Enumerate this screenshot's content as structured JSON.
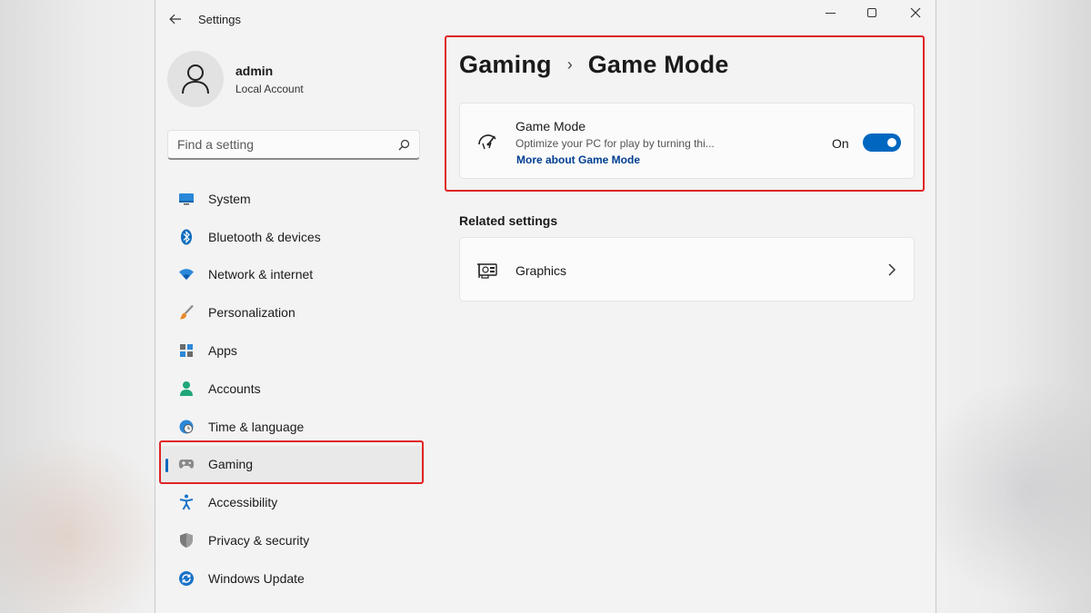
{
  "window": {
    "app_title": "Settings"
  },
  "user": {
    "name": "admin",
    "account_type": "Local Account"
  },
  "search": {
    "placeholder": "Find a setting"
  },
  "sidebar": {
    "items": [
      {
        "label": "System",
        "icon": "monitor-icon"
      },
      {
        "label": "Bluetooth & devices",
        "icon": "bluetooth-icon"
      },
      {
        "label": "Network & internet",
        "icon": "wifi-icon"
      },
      {
        "label": "Personalization",
        "icon": "brush-icon"
      },
      {
        "label": "Apps",
        "icon": "apps-icon"
      },
      {
        "label": "Accounts",
        "icon": "person-icon"
      },
      {
        "label": "Time & language",
        "icon": "globe-clock-icon"
      },
      {
        "label": "Gaming",
        "icon": "gamepad-icon",
        "selected": true
      },
      {
        "label": "Accessibility",
        "icon": "accessibility-icon"
      },
      {
        "label": "Privacy & security",
        "icon": "shield-icon"
      },
      {
        "label": "Windows Update",
        "icon": "update-icon"
      }
    ]
  },
  "breadcrumb": {
    "parent": "Gaming",
    "separator": "›",
    "current": "Game Mode"
  },
  "game_mode": {
    "title": "Game Mode",
    "description": "Optimize your PC for play by turning thi...",
    "link": "More about Game Mode",
    "state_label": "On",
    "enabled": true
  },
  "related": {
    "heading": "Related settings",
    "items": [
      {
        "label": "Graphics",
        "icon": "graphics-card-icon"
      }
    ]
  },
  "colors": {
    "accent": "#0067c0",
    "highlight": "#e02424",
    "link": "#003e92"
  }
}
